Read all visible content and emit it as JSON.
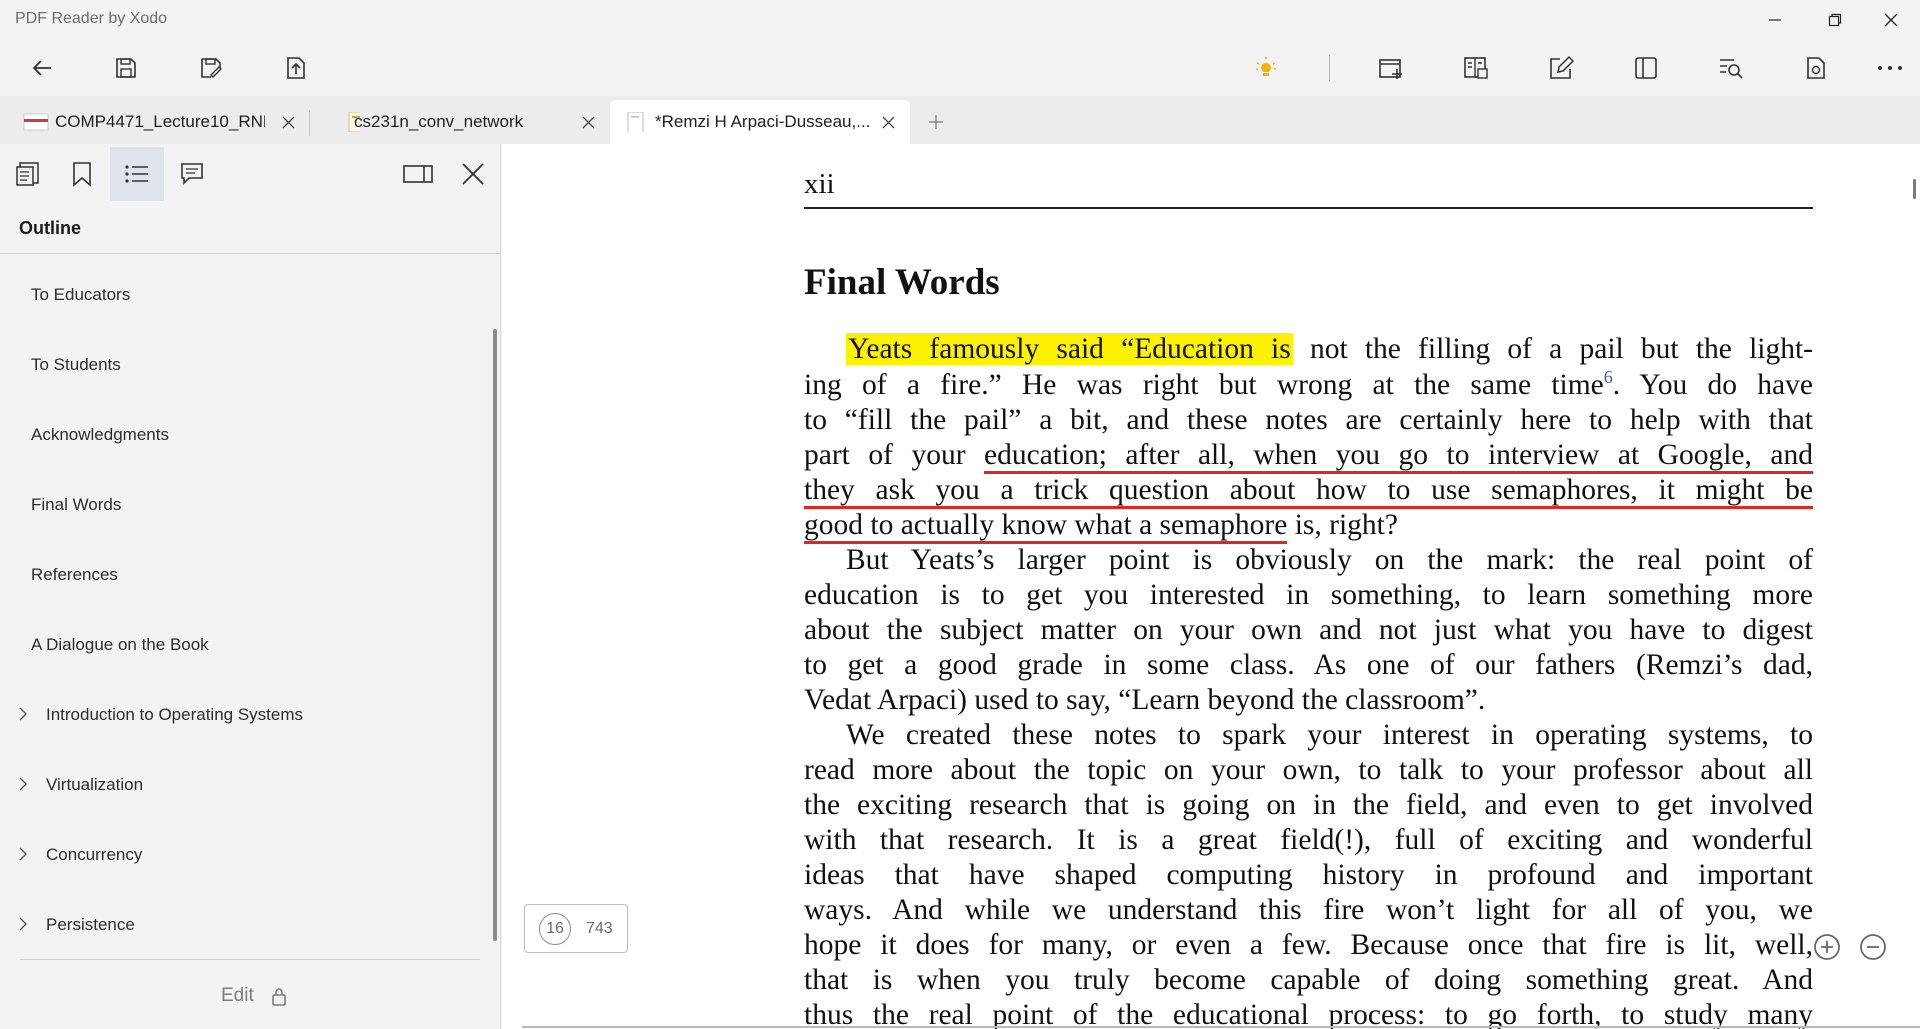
{
  "window": {
    "title": "PDF Reader by Xodo"
  },
  "toolbar": {
    "left_icons": [
      "back-arrow-icon",
      "save-icon",
      "save-as-icon",
      "export-icon"
    ],
    "right_icons": [
      "lightbulb-icon",
      "add-page-icon",
      "view-mode-icon",
      "edit-icon",
      "panel-icon",
      "search-icon",
      "file-info-icon",
      "more-icon"
    ],
    "accent": "#f5b400"
  },
  "tabs": [
    {
      "label": "COMP4471_Lecture10_RNN",
      "active": false
    },
    {
      "label": "cs231n_conv_network",
      "active": false
    },
    {
      "label": "*Remzi H Arpaci-Dusseau,...",
      "active": true
    }
  ],
  "sidebar": {
    "heading": "Outline",
    "items": [
      {
        "label": "To Educators",
        "expandable": false
      },
      {
        "label": "To Students",
        "expandable": false
      },
      {
        "label": "Acknowledgments",
        "expandable": false
      },
      {
        "label": "Final Words",
        "expandable": false
      },
      {
        "label": "References",
        "expandable": false
      },
      {
        "label": "A Dialogue on the Book",
        "expandable": false
      },
      {
        "label": "Introduction to Operating Systems",
        "expandable": true
      },
      {
        "label": "Virtualization",
        "expandable": true
      },
      {
        "label": "Concurrency",
        "expandable": true
      },
      {
        "label": "Persistence",
        "expandable": true
      }
    ],
    "edit_label": "Edit"
  },
  "document": {
    "page_header": "xii",
    "section_title": "Final Words",
    "lines": {
      "l1a": "Yeats famously said “Education is",
      "l1b": " not the filling of a pail but the light-",
      "l2a": "ing of a fire.”  He was right but wrong at the same time",
      "l2sup": "6",
      "l2b": ".  You do have",
      "l3": "to “fill the pail” a bit, and these notes are certainly here to help with that",
      "l4a": "part of your ",
      "l4b": "education; after all, when you go to interview at Google, and",
      "l5": "they ask you a trick question about how to use semaphores, it might be",
      "l6a": "good to actually know what a semaphore",
      "l6b": " is, right?",
      "l7": "But Yeats’s larger point is obviously on the mark:  the real point of",
      "l8": "education is to get you interested in something, to learn something more",
      "l9": "about the subject matter on your own and not just what you have to digest",
      "l10": "to get a good grade in some class.  As one of our fathers (Remzi’s dad,",
      "l11": "Vedat Arpaci) used to say, “Learn beyond the classroom”.",
      "l12": "We created these notes to spark your interest in operating systems, to",
      "l13": "read more about the topic on your own, to talk to your professor about all",
      "l14": "the exciting research that is going on in the field, and even to get involved",
      "l15": "with that research.  It is a great field(!), full of exciting and wonderful",
      "l16": "ideas that have shaped computing history in profound and important",
      "l17": "ways.  And while we understand this fire won’t light for all of you, we",
      "l18": "hope it does for many, or even a few.  Because once that fire is lit, well,",
      "l19": "that is when you truly become capable of doing something great.  And",
      "l20": "thus the real point of the educational process: to go forth, to study many"
    },
    "highlight_color": "#fff200",
    "underline_color": "#e8231e"
  },
  "page_indicator": {
    "current": "16",
    "total": "743"
  }
}
